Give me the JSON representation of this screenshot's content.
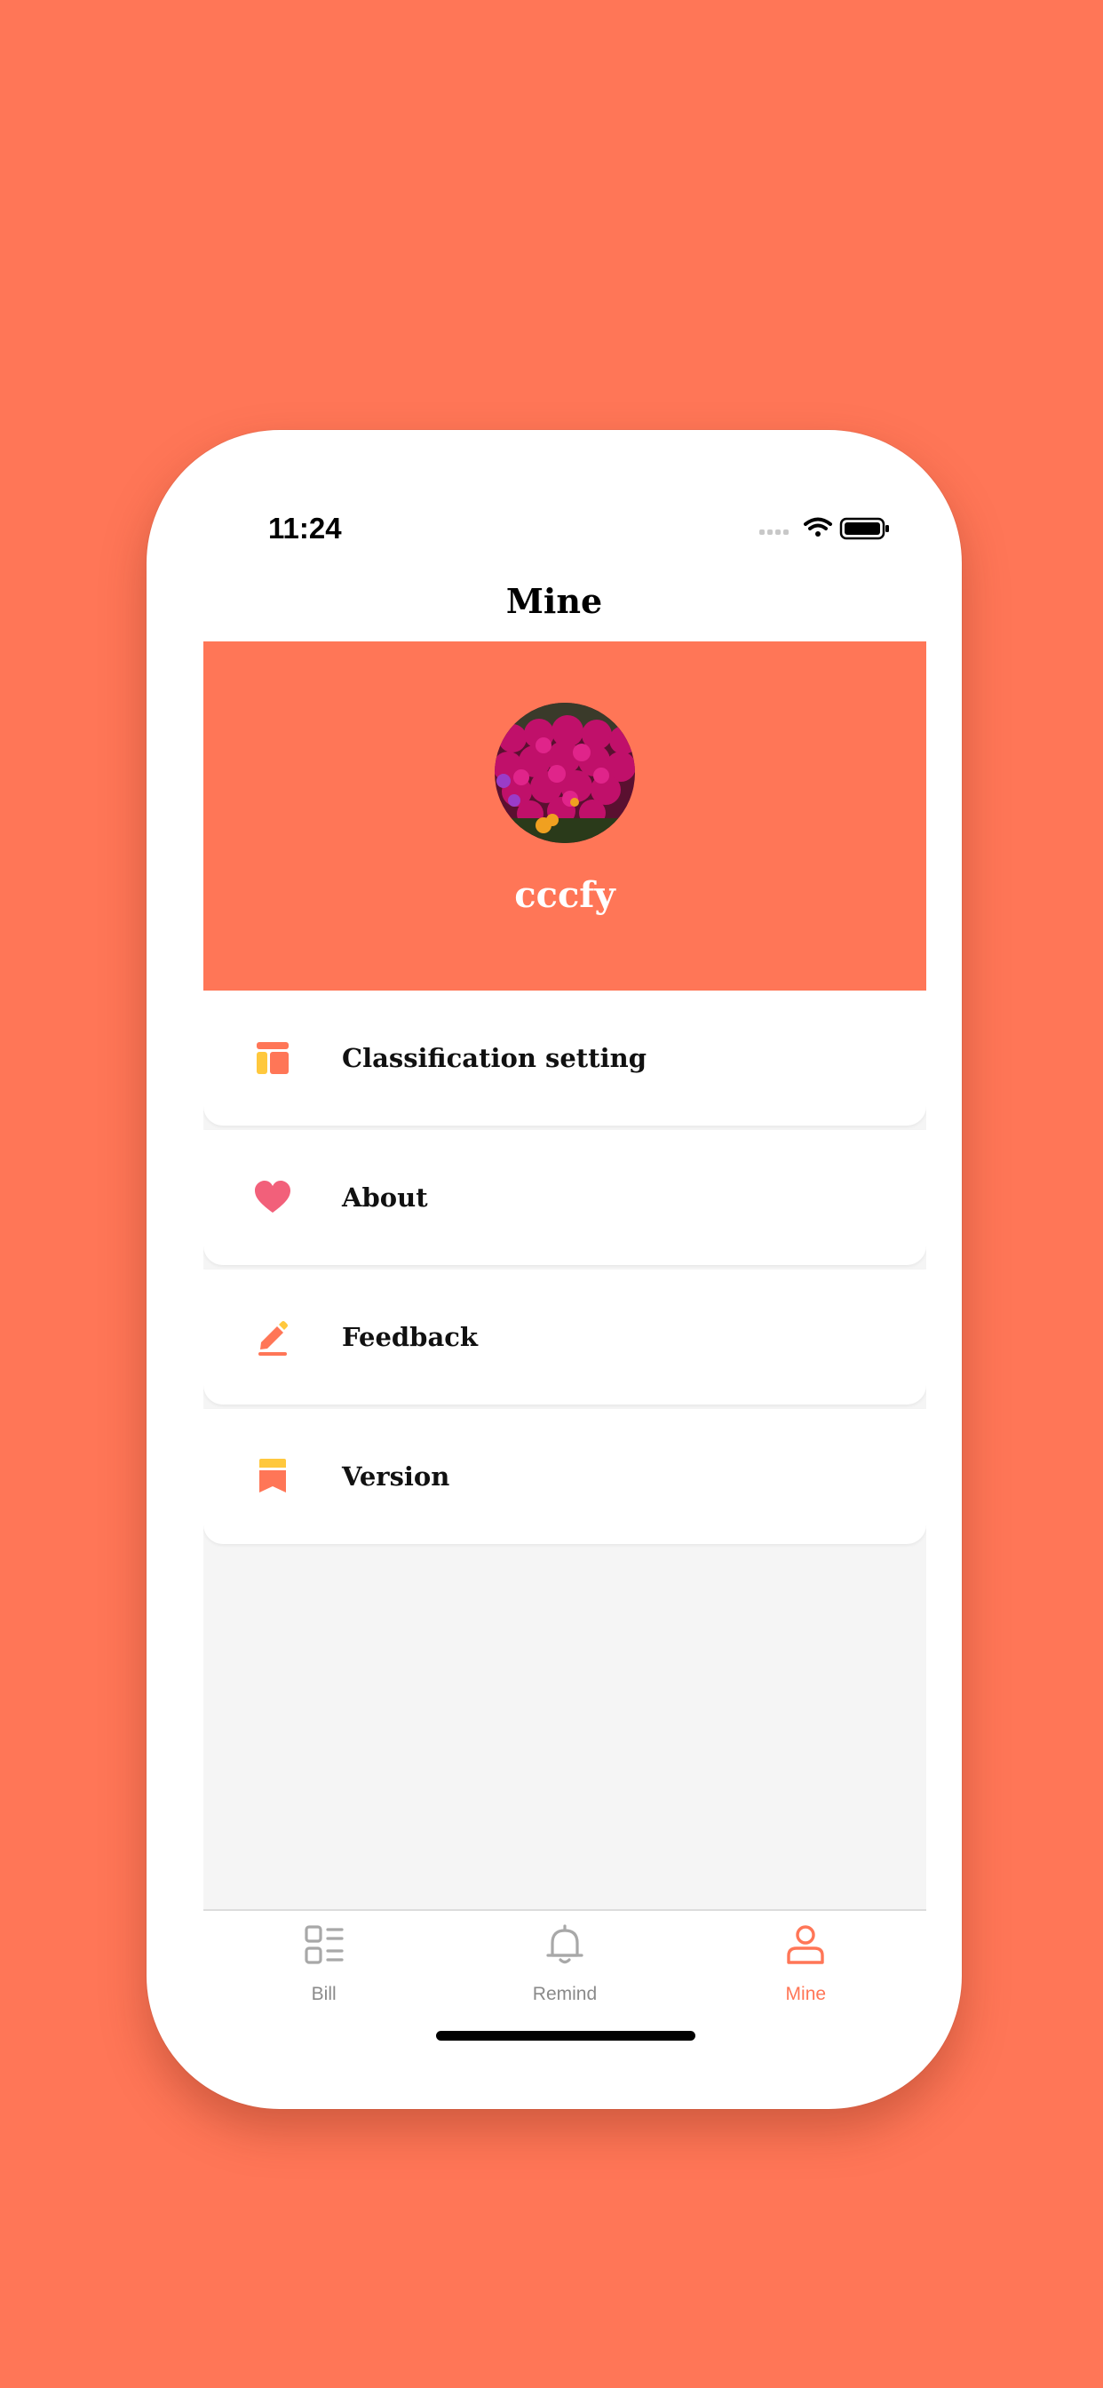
{
  "status_bar": {
    "time": "11:24"
  },
  "navbar": {
    "title": "Mine"
  },
  "profile": {
    "username": "cccfy"
  },
  "menu": {
    "items": [
      {
        "label": "Classification setting",
        "icon": "classification-icon"
      },
      {
        "label": "About",
        "icon": "heart-icon"
      },
      {
        "label": "Feedback",
        "icon": "pencil-icon"
      },
      {
        "label": "Version",
        "icon": "bookmark-icon"
      }
    ]
  },
  "tabbar": {
    "tabs": [
      {
        "label": "Bill",
        "icon": "list-icon",
        "active": false
      },
      {
        "label": "Remind",
        "icon": "bell-icon",
        "active": false
      },
      {
        "label": "Mine",
        "icon": "person-icon",
        "active": true
      }
    ]
  },
  "colors": {
    "accent": "#FF7657",
    "yellow": "#FFC83D",
    "pink": "#F2607A",
    "inactive": "#9a9a9a"
  }
}
